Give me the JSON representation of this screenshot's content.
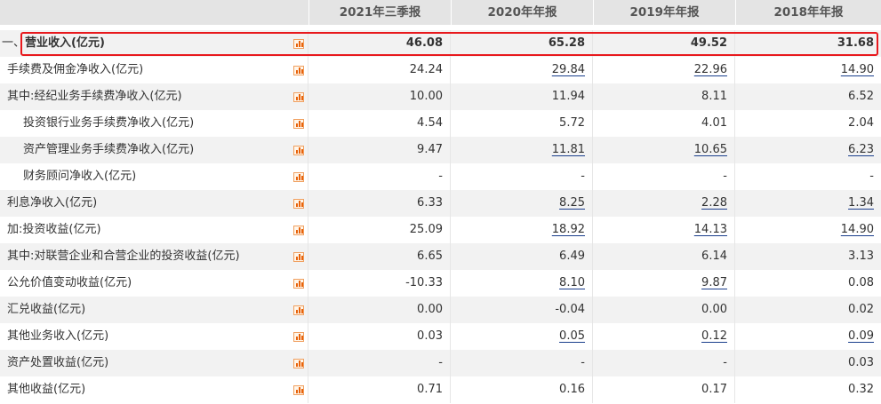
{
  "columns": [
    "2021年三季报",
    "2020年年报",
    "2019年年报",
    "2018年年报"
  ],
  "rows": [
    {
      "prefix": "一、",
      "label": "营业收入(亿元)",
      "values": [
        "46.08",
        "65.28",
        "49.52",
        "31.68"
      ],
      "links": [
        false,
        false,
        false,
        false
      ],
      "bold": true,
      "indent": false
    },
    {
      "label": "手续费及佣金净收入(亿元)",
      "values": [
        "24.24",
        "29.84",
        "22.96",
        "14.90"
      ],
      "links": [
        false,
        true,
        true,
        true
      ]
    },
    {
      "label": "其中:经纪业务手续费净收入(亿元)",
      "values": [
        "10.00",
        "11.94",
        "8.11",
        "6.52"
      ],
      "links": [
        false,
        false,
        false,
        false
      ]
    },
    {
      "label": "投资银行业务手续费净收入(亿元)",
      "values": [
        "4.54",
        "5.72",
        "4.01",
        "2.04"
      ],
      "links": [
        false,
        false,
        false,
        false
      ],
      "indent": true
    },
    {
      "label": "资产管理业务手续费净收入(亿元)",
      "values": [
        "9.47",
        "11.81",
        "10.65",
        "6.23"
      ],
      "links": [
        false,
        true,
        true,
        true
      ],
      "indent": true
    },
    {
      "label": "财务顾问净收入(亿元)",
      "values": [
        "-",
        "-",
        "-",
        "-"
      ],
      "links": [
        false,
        false,
        false,
        false
      ],
      "indent": true
    },
    {
      "label": "利息净收入(亿元)",
      "values": [
        "6.33",
        "8.25",
        "2.28",
        "1.34"
      ],
      "links": [
        false,
        true,
        true,
        true
      ]
    },
    {
      "label": "加:投资收益(亿元)",
      "values": [
        "25.09",
        "18.92",
        "14.13",
        "14.90"
      ],
      "links": [
        false,
        true,
        true,
        true
      ]
    },
    {
      "label": "其中:对联营企业和合营企业的投资收益(亿元)",
      "values": [
        "6.65",
        "6.49",
        "6.14",
        "3.13"
      ],
      "links": [
        false,
        false,
        false,
        false
      ]
    },
    {
      "label": "公允价值变动收益(亿元)",
      "values": [
        "-10.33",
        "8.10",
        "9.87",
        "0.08"
      ],
      "links": [
        false,
        true,
        true,
        false
      ]
    },
    {
      "label": "汇兑收益(亿元)",
      "values": [
        "0.00",
        "-0.04",
        "0.00",
        "0.02"
      ],
      "links": [
        false,
        false,
        false,
        false
      ]
    },
    {
      "label": "其他业务收入(亿元)",
      "values": [
        "0.03",
        "0.05",
        "0.12",
        "0.09"
      ],
      "links": [
        false,
        true,
        true,
        true
      ]
    },
    {
      "label": "资产处置收益(亿元)",
      "values": [
        "-",
        "-",
        "-",
        "0.03"
      ],
      "links": [
        false,
        false,
        false,
        false
      ]
    },
    {
      "label": "其他收益(亿元)",
      "values": [
        "0.71",
        "0.16",
        "0.17",
        "0.32"
      ],
      "links": [
        false,
        false,
        false,
        false
      ]
    }
  ],
  "colors": {
    "highlight": "#e8191d",
    "link_underline": "#1a3e8c",
    "chart_icon": "#e8620a"
  }
}
